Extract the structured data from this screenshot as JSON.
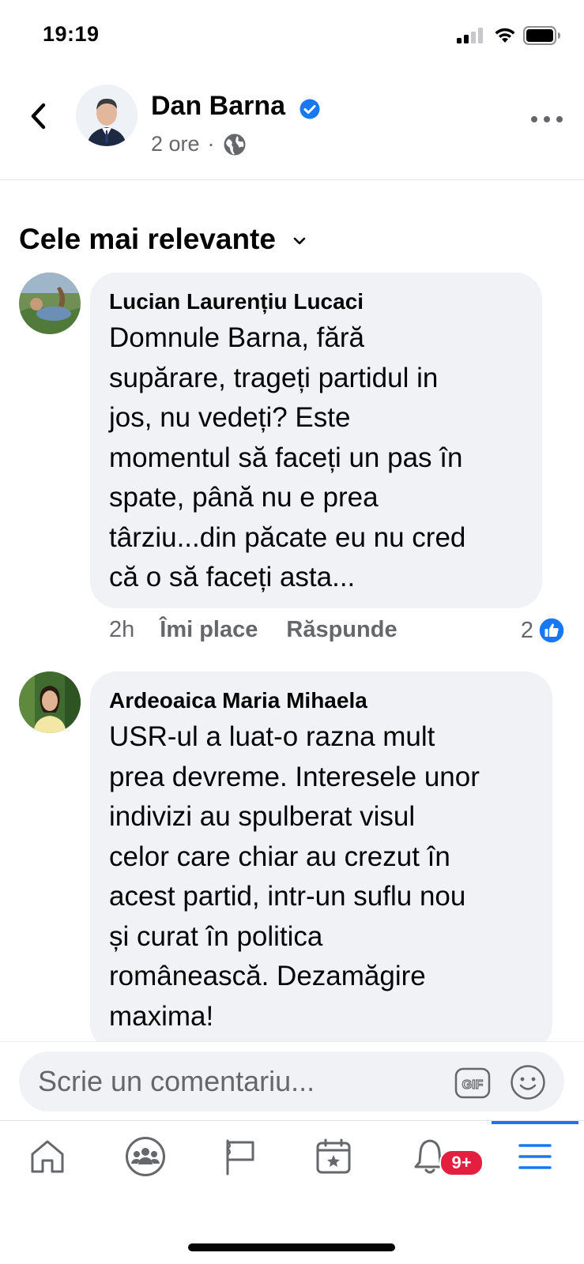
{
  "status_bar": {
    "time": "19:19"
  },
  "post": {
    "author": "Dan Barna",
    "time": "2 ore",
    "separator": "·"
  },
  "sort": {
    "label": "Cele mai relevante"
  },
  "comments": [
    {
      "author": "Lucian Laurențiu Lucaci",
      "text": "Domnule Barna, fără\nsupărare, trageți partidul in\njos, nu vedeți? Este\nmomentul să faceți un pas în\nspate, până nu e prea\ntârziu...din păcate eu nu cred\ncă o să faceți asta...",
      "time": "2h",
      "like_label": "Îmi place",
      "reply_label": "Răspunde",
      "reactions": "2"
    },
    {
      "author": "Ardeoaica Maria Mihaela",
      "text": "USR-ul a luat-o razna mult\nprea devreme. Interesele unor\nindivizi au spulberat visul\ncelor care chiar au crezut în\nacest partid, intr-un suflu nou\nși curat în politica\nromânească. Dezamăgire\nmaxima!"
    }
  ],
  "composer": {
    "placeholder": "Scrie un comentariu...",
    "gif_label": "GIF"
  },
  "tab_bar": {
    "items": [
      "home-icon",
      "groups-icon",
      "pages-flag-icon",
      "events-icon",
      "notifications-bell-icon",
      "menu-icon"
    ],
    "notifications_badge": "9+",
    "active": "menu-icon"
  },
  "colors": {
    "accent": "#1877f2",
    "badge": "#e41e3f",
    "bubble": "#f0f2f5",
    "secondary_text": "#65676b"
  }
}
